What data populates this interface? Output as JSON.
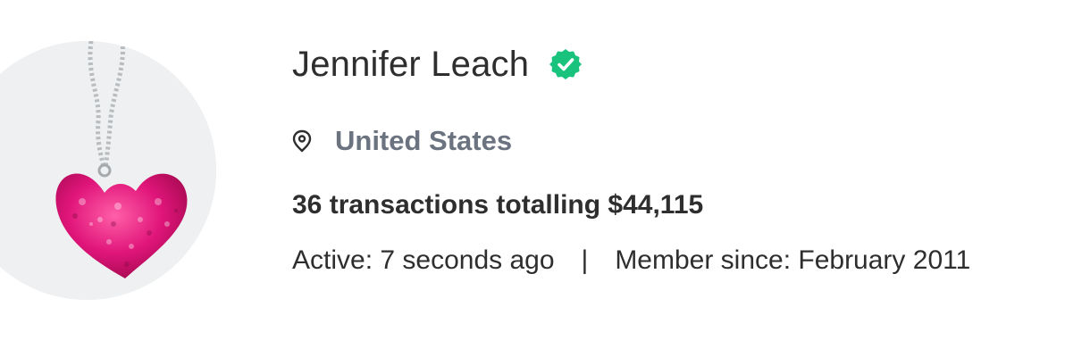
{
  "profile": {
    "avatar_icon": "heart-pendant-necklace-photo",
    "name": "Jennifer Leach",
    "verified_icon": "verified-check-badge-icon",
    "verified_color": "#19c37d",
    "location_icon": "location-pin-icon",
    "location": "United States",
    "location_color": "#6b7280",
    "transactions": "36 transactions totalling $44,115",
    "active": "Active: 7 seconds ago",
    "separator": "|",
    "member_since": "Member since: February 2011"
  }
}
